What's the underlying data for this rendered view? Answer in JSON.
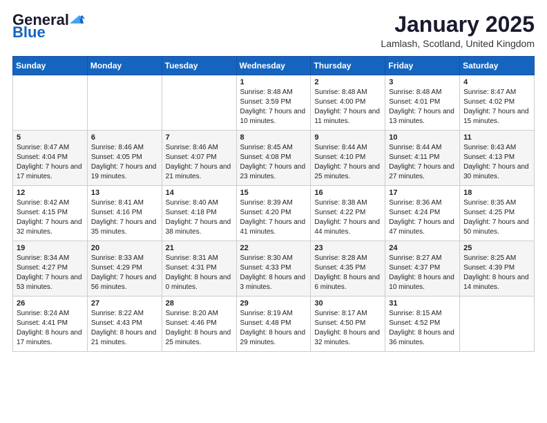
{
  "logo": {
    "general": "General",
    "blue": "Blue"
  },
  "header": {
    "month_title": "January 2025",
    "location": "Lamlash, Scotland, United Kingdom"
  },
  "weekdays": [
    "Sunday",
    "Monday",
    "Tuesday",
    "Wednesday",
    "Thursday",
    "Friday",
    "Saturday"
  ],
  "weeks": [
    [
      {
        "day": "",
        "sunrise": "",
        "sunset": "",
        "daylight": ""
      },
      {
        "day": "",
        "sunrise": "",
        "sunset": "",
        "daylight": ""
      },
      {
        "day": "",
        "sunrise": "",
        "sunset": "",
        "daylight": ""
      },
      {
        "day": "1",
        "sunrise": "Sunrise: 8:48 AM",
        "sunset": "Sunset: 3:59 PM",
        "daylight": "Daylight: 7 hours and 10 minutes."
      },
      {
        "day": "2",
        "sunrise": "Sunrise: 8:48 AM",
        "sunset": "Sunset: 4:00 PM",
        "daylight": "Daylight: 7 hours and 11 minutes."
      },
      {
        "day": "3",
        "sunrise": "Sunrise: 8:48 AM",
        "sunset": "Sunset: 4:01 PM",
        "daylight": "Daylight: 7 hours and 13 minutes."
      },
      {
        "day": "4",
        "sunrise": "Sunrise: 8:47 AM",
        "sunset": "Sunset: 4:02 PM",
        "daylight": "Daylight: 7 hours and 15 minutes."
      }
    ],
    [
      {
        "day": "5",
        "sunrise": "Sunrise: 8:47 AM",
        "sunset": "Sunset: 4:04 PM",
        "daylight": "Daylight: 7 hours and 17 minutes."
      },
      {
        "day": "6",
        "sunrise": "Sunrise: 8:46 AM",
        "sunset": "Sunset: 4:05 PM",
        "daylight": "Daylight: 7 hours and 19 minutes."
      },
      {
        "day": "7",
        "sunrise": "Sunrise: 8:46 AM",
        "sunset": "Sunset: 4:07 PM",
        "daylight": "Daylight: 7 hours and 21 minutes."
      },
      {
        "day": "8",
        "sunrise": "Sunrise: 8:45 AM",
        "sunset": "Sunset: 4:08 PM",
        "daylight": "Daylight: 7 hours and 23 minutes."
      },
      {
        "day": "9",
        "sunrise": "Sunrise: 8:44 AM",
        "sunset": "Sunset: 4:10 PM",
        "daylight": "Daylight: 7 hours and 25 minutes."
      },
      {
        "day": "10",
        "sunrise": "Sunrise: 8:44 AM",
        "sunset": "Sunset: 4:11 PM",
        "daylight": "Daylight: 7 hours and 27 minutes."
      },
      {
        "day": "11",
        "sunrise": "Sunrise: 8:43 AM",
        "sunset": "Sunset: 4:13 PM",
        "daylight": "Daylight: 7 hours and 30 minutes."
      }
    ],
    [
      {
        "day": "12",
        "sunrise": "Sunrise: 8:42 AM",
        "sunset": "Sunset: 4:15 PM",
        "daylight": "Daylight: 7 hours and 32 minutes."
      },
      {
        "day": "13",
        "sunrise": "Sunrise: 8:41 AM",
        "sunset": "Sunset: 4:16 PM",
        "daylight": "Daylight: 7 hours and 35 minutes."
      },
      {
        "day": "14",
        "sunrise": "Sunrise: 8:40 AM",
        "sunset": "Sunset: 4:18 PM",
        "daylight": "Daylight: 7 hours and 38 minutes."
      },
      {
        "day": "15",
        "sunrise": "Sunrise: 8:39 AM",
        "sunset": "Sunset: 4:20 PM",
        "daylight": "Daylight: 7 hours and 41 minutes."
      },
      {
        "day": "16",
        "sunrise": "Sunrise: 8:38 AM",
        "sunset": "Sunset: 4:22 PM",
        "daylight": "Daylight: 7 hours and 44 minutes."
      },
      {
        "day": "17",
        "sunrise": "Sunrise: 8:36 AM",
        "sunset": "Sunset: 4:24 PM",
        "daylight": "Daylight: 7 hours and 47 minutes."
      },
      {
        "day": "18",
        "sunrise": "Sunrise: 8:35 AM",
        "sunset": "Sunset: 4:25 PM",
        "daylight": "Daylight: 7 hours and 50 minutes."
      }
    ],
    [
      {
        "day": "19",
        "sunrise": "Sunrise: 8:34 AM",
        "sunset": "Sunset: 4:27 PM",
        "daylight": "Daylight: 7 hours and 53 minutes."
      },
      {
        "day": "20",
        "sunrise": "Sunrise: 8:33 AM",
        "sunset": "Sunset: 4:29 PM",
        "daylight": "Daylight: 7 hours and 56 minutes."
      },
      {
        "day": "21",
        "sunrise": "Sunrise: 8:31 AM",
        "sunset": "Sunset: 4:31 PM",
        "daylight": "Daylight: 8 hours and 0 minutes."
      },
      {
        "day": "22",
        "sunrise": "Sunrise: 8:30 AM",
        "sunset": "Sunset: 4:33 PM",
        "daylight": "Daylight: 8 hours and 3 minutes."
      },
      {
        "day": "23",
        "sunrise": "Sunrise: 8:28 AM",
        "sunset": "Sunset: 4:35 PM",
        "daylight": "Daylight: 8 hours and 6 minutes."
      },
      {
        "day": "24",
        "sunrise": "Sunrise: 8:27 AM",
        "sunset": "Sunset: 4:37 PM",
        "daylight": "Daylight: 8 hours and 10 minutes."
      },
      {
        "day": "25",
        "sunrise": "Sunrise: 8:25 AM",
        "sunset": "Sunset: 4:39 PM",
        "daylight": "Daylight: 8 hours and 14 minutes."
      }
    ],
    [
      {
        "day": "26",
        "sunrise": "Sunrise: 8:24 AM",
        "sunset": "Sunset: 4:41 PM",
        "daylight": "Daylight: 8 hours and 17 minutes."
      },
      {
        "day": "27",
        "sunrise": "Sunrise: 8:22 AM",
        "sunset": "Sunset: 4:43 PM",
        "daylight": "Daylight: 8 hours and 21 minutes."
      },
      {
        "day": "28",
        "sunrise": "Sunrise: 8:20 AM",
        "sunset": "Sunset: 4:46 PM",
        "daylight": "Daylight: 8 hours and 25 minutes."
      },
      {
        "day": "29",
        "sunrise": "Sunrise: 8:19 AM",
        "sunset": "Sunset: 4:48 PM",
        "daylight": "Daylight: 8 hours and 29 minutes."
      },
      {
        "day": "30",
        "sunrise": "Sunrise: 8:17 AM",
        "sunset": "Sunset: 4:50 PM",
        "daylight": "Daylight: 8 hours and 32 minutes."
      },
      {
        "day": "31",
        "sunrise": "Sunrise: 8:15 AM",
        "sunset": "Sunset: 4:52 PM",
        "daylight": "Daylight: 8 hours and 36 minutes."
      },
      {
        "day": "",
        "sunrise": "",
        "sunset": "",
        "daylight": ""
      }
    ]
  ]
}
